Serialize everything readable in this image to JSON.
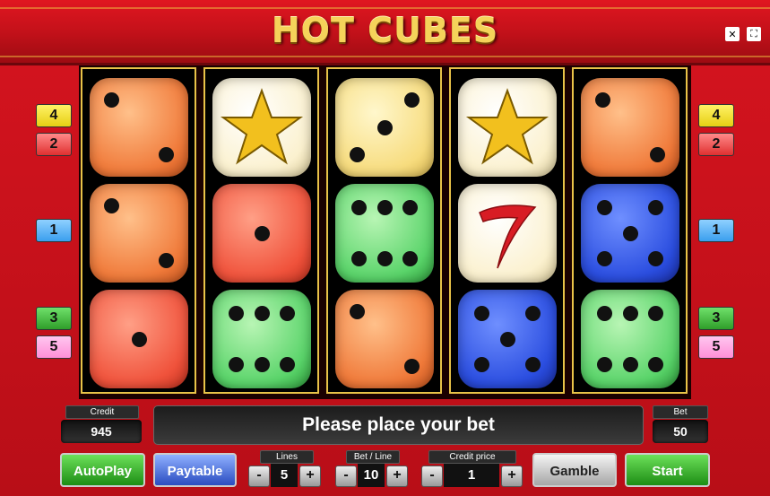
{
  "header": {
    "title": "HOT CUBES",
    "icons": [
      "no-sound-icon",
      "fullscreen-icon"
    ]
  },
  "reels": [
    {
      "cubes": [
        {
          "color": "orange",
          "symbol": "two"
        },
        {
          "color": "orange",
          "symbol": "two"
        },
        {
          "color": "red",
          "symbol": "one"
        }
      ]
    },
    {
      "cubes": [
        {
          "color": "cream",
          "symbol": "star"
        },
        {
          "color": "red",
          "symbol": "one"
        },
        {
          "color": "green",
          "symbol": "six"
        }
      ]
    },
    {
      "cubes": [
        {
          "color": "yellow",
          "symbol": "three"
        },
        {
          "color": "green",
          "symbol": "six"
        },
        {
          "color": "orange",
          "symbol": "two"
        }
      ]
    },
    {
      "cubes": [
        {
          "color": "cream",
          "symbol": "star"
        },
        {
          "color": "cream",
          "symbol": "seven"
        },
        {
          "color": "blue",
          "symbol": "five"
        }
      ]
    },
    {
      "cubes": [
        {
          "color": "orange",
          "symbol": "two"
        },
        {
          "color": "blue",
          "symbol": "five"
        },
        {
          "color": "green",
          "symbol": "six"
        }
      ]
    }
  ],
  "line_badges_left": [
    "4",
    "2",
    "1",
    "3",
    "5"
  ],
  "line_badges_right": [
    "4",
    "2",
    "1",
    "3",
    "5"
  ],
  "credit": {
    "label": "Credit",
    "value": "945"
  },
  "bet": {
    "label": "Bet",
    "value": "50"
  },
  "message": "Please place your bet",
  "controls": {
    "autoplay": "AutoPlay",
    "paytable": "Paytable",
    "gamble": "Gamble",
    "start": "Start",
    "lines": {
      "label": "Lines",
      "value": "5",
      "minus": "-",
      "plus": "+"
    },
    "bet_line": {
      "label": "Bet / Line",
      "value": "10",
      "minus": "-",
      "plus": "+"
    },
    "credit_price": {
      "label": "Credit price",
      "value": "1",
      "minus": "-",
      "plus": "+"
    }
  }
}
